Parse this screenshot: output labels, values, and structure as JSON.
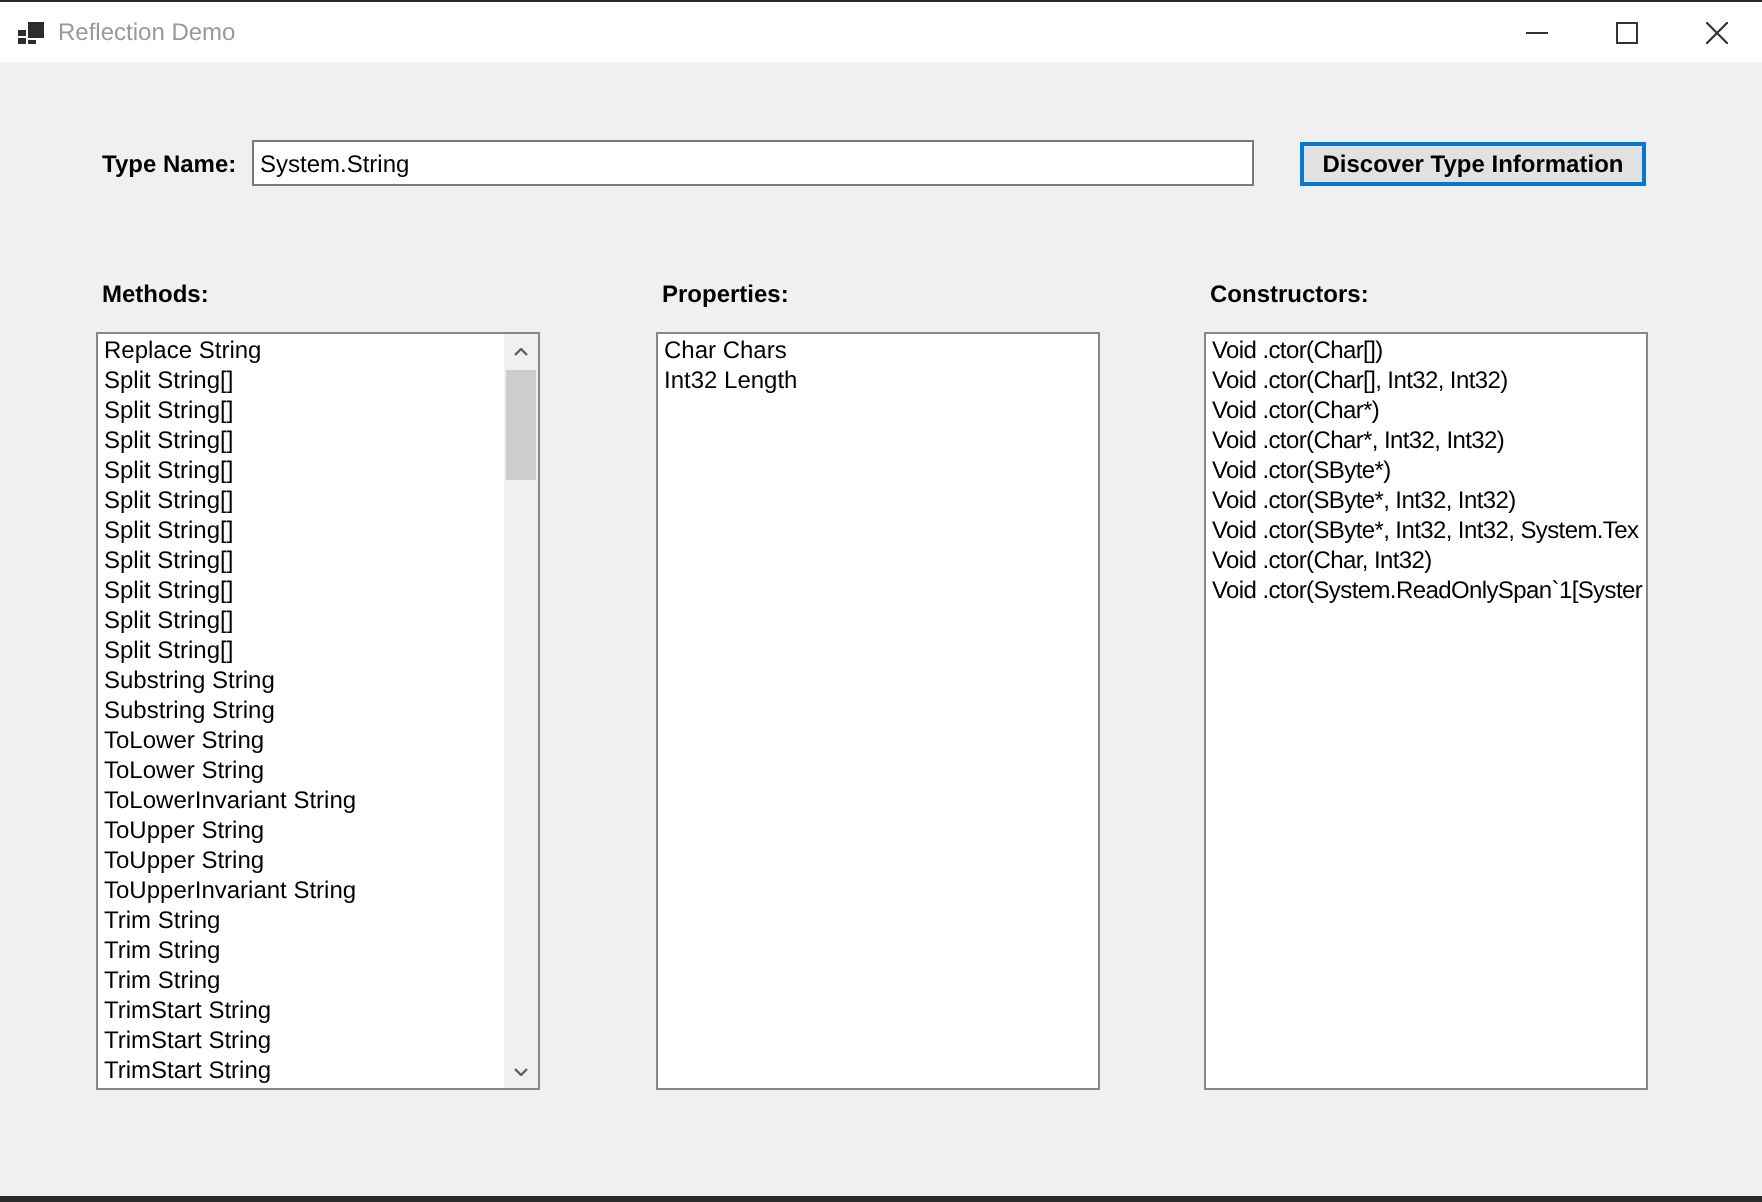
{
  "window": {
    "title": "Reflection Demo"
  },
  "type_name": {
    "label": "Type Name:",
    "value": "System.String"
  },
  "discover_button": {
    "label": "Discover Type Information",
    "focused": true
  },
  "methods": {
    "label": "Methods:",
    "items": [
      {
        "text": "Replace String",
        "selected": false
      },
      {
        "text": "Split String[]",
        "selected": false
      },
      {
        "text": "Split String[]",
        "selected": false
      },
      {
        "text": "Split String[]",
        "selected": false
      },
      {
        "text": "Split String[]",
        "selected": false
      },
      {
        "text": "Split String[]",
        "selected": false
      },
      {
        "text": "Split String[]",
        "selected": false
      },
      {
        "text": "Split String[]",
        "selected": false
      },
      {
        "text": "Split String[]",
        "selected": false
      },
      {
        "text": "Split String[]",
        "selected": false
      },
      {
        "text": "Split String[]",
        "selected": false
      },
      {
        "text": "Substring String",
        "selected": false
      },
      {
        "text": "Substring String",
        "selected": false
      },
      {
        "text": "ToLower String",
        "selected": false
      },
      {
        "text": "ToLower String",
        "selected": false
      },
      {
        "text": "ToLowerInvariant String",
        "selected": false
      },
      {
        "text": "ToUpper String",
        "selected": false
      },
      {
        "text": "ToUpper String",
        "selected": false
      },
      {
        "text": "ToUpperInvariant String",
        "selected": false
      },
      {
        "text": "Trim String",
        "selected": false
      },
      {
        "text": "Trim String",
        "selected": false
      },
      {
        "text": "Trim String",
        "selected": false
      },
      {
        "text": "TrimStart String",
        "selected": false
      },
      {
        "text": "TrimStart String",
        "selected": false
      },
      {
        "text": "TrimStart String",
        "selected": false
      }
    ]
  },
  "properties": {
    "label": "Properties:",
    "items": [
      {
        "text": "Char Chars",
        "selected": false
      },
      {
        "text": "Int32 Length",
        "selected": false
      }
    ]
  },
  "constructors": {
    "label": "Constructors:",
    "items": [
      {
        "text": "Void .ctor(Char[])",
        "selected": false
      },
      {
        "text": "Void .ctor(Char[], Int32, Int32)",
        "selected": false
      },
      {
        "text": "Void .ctor(Char*)",
        "selected": false
      },
      {
        "text": "Void .ctor(Char*, Int32, Int32)",
        "selected": false
      },
      {
        "text": "Void .ctor(SByte*)",
        "selected": false
      },
      {
        "text": "Void .ctor(SByte*, Int32, Int32)",
        "selected": false
      },
      {
        "text": "Void .ctor(SByte*, Int32, Int32, System.Tex",
        "selected": false
      },
      {
        "text": "Void .ctor(Char, Int32)",
        "selected": false
      },
      {
        "text": "Void .ctor(System.ReadOnlySpan`1[Syster",
        "selected": false
      }
    ]
  }
}
